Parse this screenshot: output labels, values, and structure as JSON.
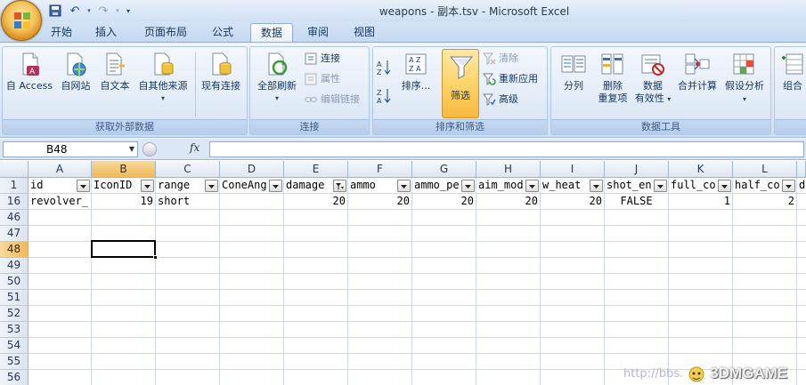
{
  "window": {
    "title": "weapons - 副本.tsv - Microsoft Excel"
  },
  "tabs": [
    {
      "label": "开始",
      "active": false
    },
    {
      "label": "插入",
      "active": false
    },
    {
      "label": "页面布局",
      "active": false
    },
    {
      "label": "公式",
      "active": false
    },
    {
      "label": "数据",
      "active": true
    },
    {
      "label": "审阅",
      "active": false
    },
    {
      "label": "视图",
      "active": false
    }
  ],
  "ribbon": {
    "external": {
      "label": "获取外部数据",
      "access": "自 Access",
      "web": "自网站",
      "text": "自文本",
      "other": "自其他来源",
      "existing": "现有连接"
    },
    "connections": {
      "label": "连接",
      "refresh_all": "全部刷新",
      "connections": "连接",
      "properties": "属性",
      "edit_links": "编辑链接"
    },
    "sort_filter": {
      "label": "排序和筛选",
      "sort": "排序...",
      "filter": "筛选",
      "clear": "清除",
      "reapply": "重新应用",
      "advanced": "高级"
    },
    "tools": {
      "label": "数据工具",
      "text_to_columns": "分列",
      "remove_dup_1": "删除",
      "remove_dup_2": "重复项",
      "validation_1": "数据",
      "validation_2": "有效性",
      "consolidate": "合并计算",
      "what_if": "假设分析"
    },
    "outline": {
      "group": "组合"
    }
  },
  "formula_bar": {
    "name_box": "B48",
    "fx": "fx",
    "value": ""
  },
  "columns": [
    "A",
    "B",
    "C",
    "D",
    "E",
    "F",
    "G",
    "H",
    "I",
    "J",
    "K",
    "L"
  ],
  "selected_column": "B",
  "rows": [
    "1",
    "16",
    "46",
    "47",
    "48",
    "49",
    "50",
    "51",
    "52",
    "53",
    "54",
    "55",
    "56"
  ],
  "selected_row": "48",
  "header_row": [
    "id",
    "IconID",
    "range",
    "ConeAng",
    "damage",
    "ammo",
    "ammo_pe",
    "aim_mod",
    "w_heat",
    "shot_en",
    "full_co",
    "half_co",
    "d"
  ],
  "data_row": [
    "revolver_",
    "19",
    "short",
    "",
    "20",
    "20",
    "20",
    "20",
    "20",
    "FALSE",
    "1",
    "2"
  ],
  "filter_active_column": "E",
  "colors": {
    "accent": "#f1b95c",
    "ribbon": "#dbe7f6",
    "grid": "#d0d7e5"
  },
  "watermark": {
    "url": "http://bbs.",
    "brand": "3DMGAME"
  }
}
